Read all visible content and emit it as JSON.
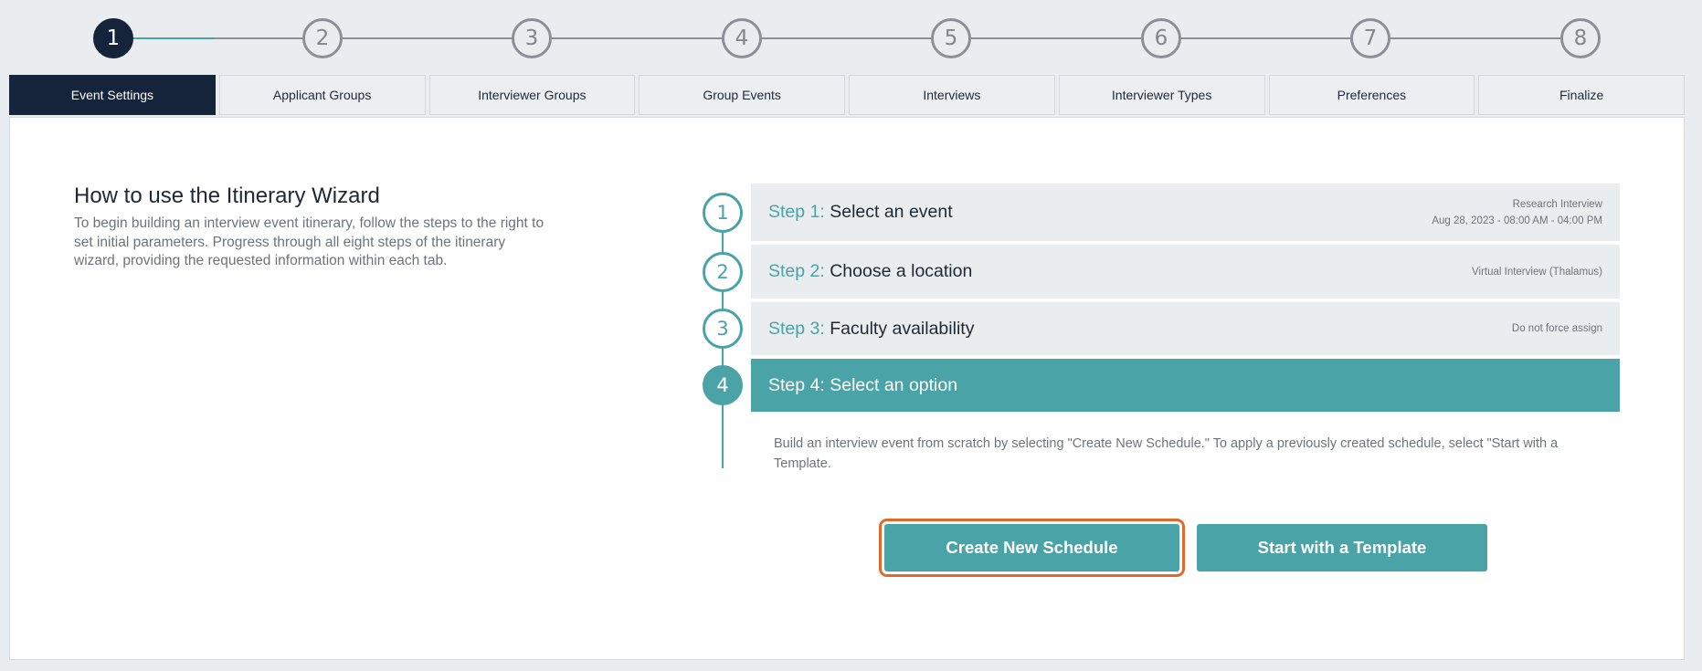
{
  "progress": {
    "steps": [
      "1",
      "2",
      "3",
      "4",
      "5",
      "6",
      "7",
      "8"
    ],
    "active_index": 0
  },
  "tabs": [
    {
      "label": "Event Settings",
      "active": true
    },
    {
      "label": "Applicant Groups",
      "active": false
    },
    {
      "label": "Interviewer Groups",
      "active": false
    },
    {
      "label": "Group Events",
      "active": false
    },
    {
      "label": "Interviews",
      "active": false
    },
    {
      "label": "Interviewer Types",
      "active": false
    },
    {
      "label": "Preferences",
      "active": false
    },
    {
      "label": "Finalize",
      "active": false
    }
  ],
  "intro": {
    "title": "How to use the Itinerary Wizard",
    "body": "To begin building an interview event itinerary, follow the steps to the right to set initial parameters. Progress through all eight steps of the itinerary wizard, providing the requested information within each tab."
  },
  "wizard_steps": [
    {
      "number": "1",
      "prefix": "Step 1:",
      "title": "Select an event",
      "meta_line1": "Research Interview",
      "meta_line2": "Aug 28, 2023 - 08:00 AM - 04:00 PM"
    },
    {
      "number": "2",
      "prefix": "Step 2:",
      "title": "Choose a location",
      "meta_line1": "Virtual Interview (Thalamus)",
      "meta_line2": ""
    },
    {
      "number": "3",
      "prefix": "Step 3:",
      "title": "Faculty availability",
      "meta_line1": "Do not force assign",
      "meta_line2": ""
    },
    {
      "number": "4",
      "prefix": "Step 4:",
      "title": "Select an option",
      "meta_line1": "",
      "meta_line2": ""
    }
  ],
  "description": "Build an interview event from scratch by selecting \"Create New Schedule.\" To apply a previously created schedule, select \"Start with a Template.",
  "buttons": {
    "create_label": "Create New Schedule",
    "template_label": "Start with a Template"
  },
  "colors": {
    "accent": "#4aa3a6",
    "navy": "#15243a",
    "focus_outline": "#e06a2b"
  }
}
